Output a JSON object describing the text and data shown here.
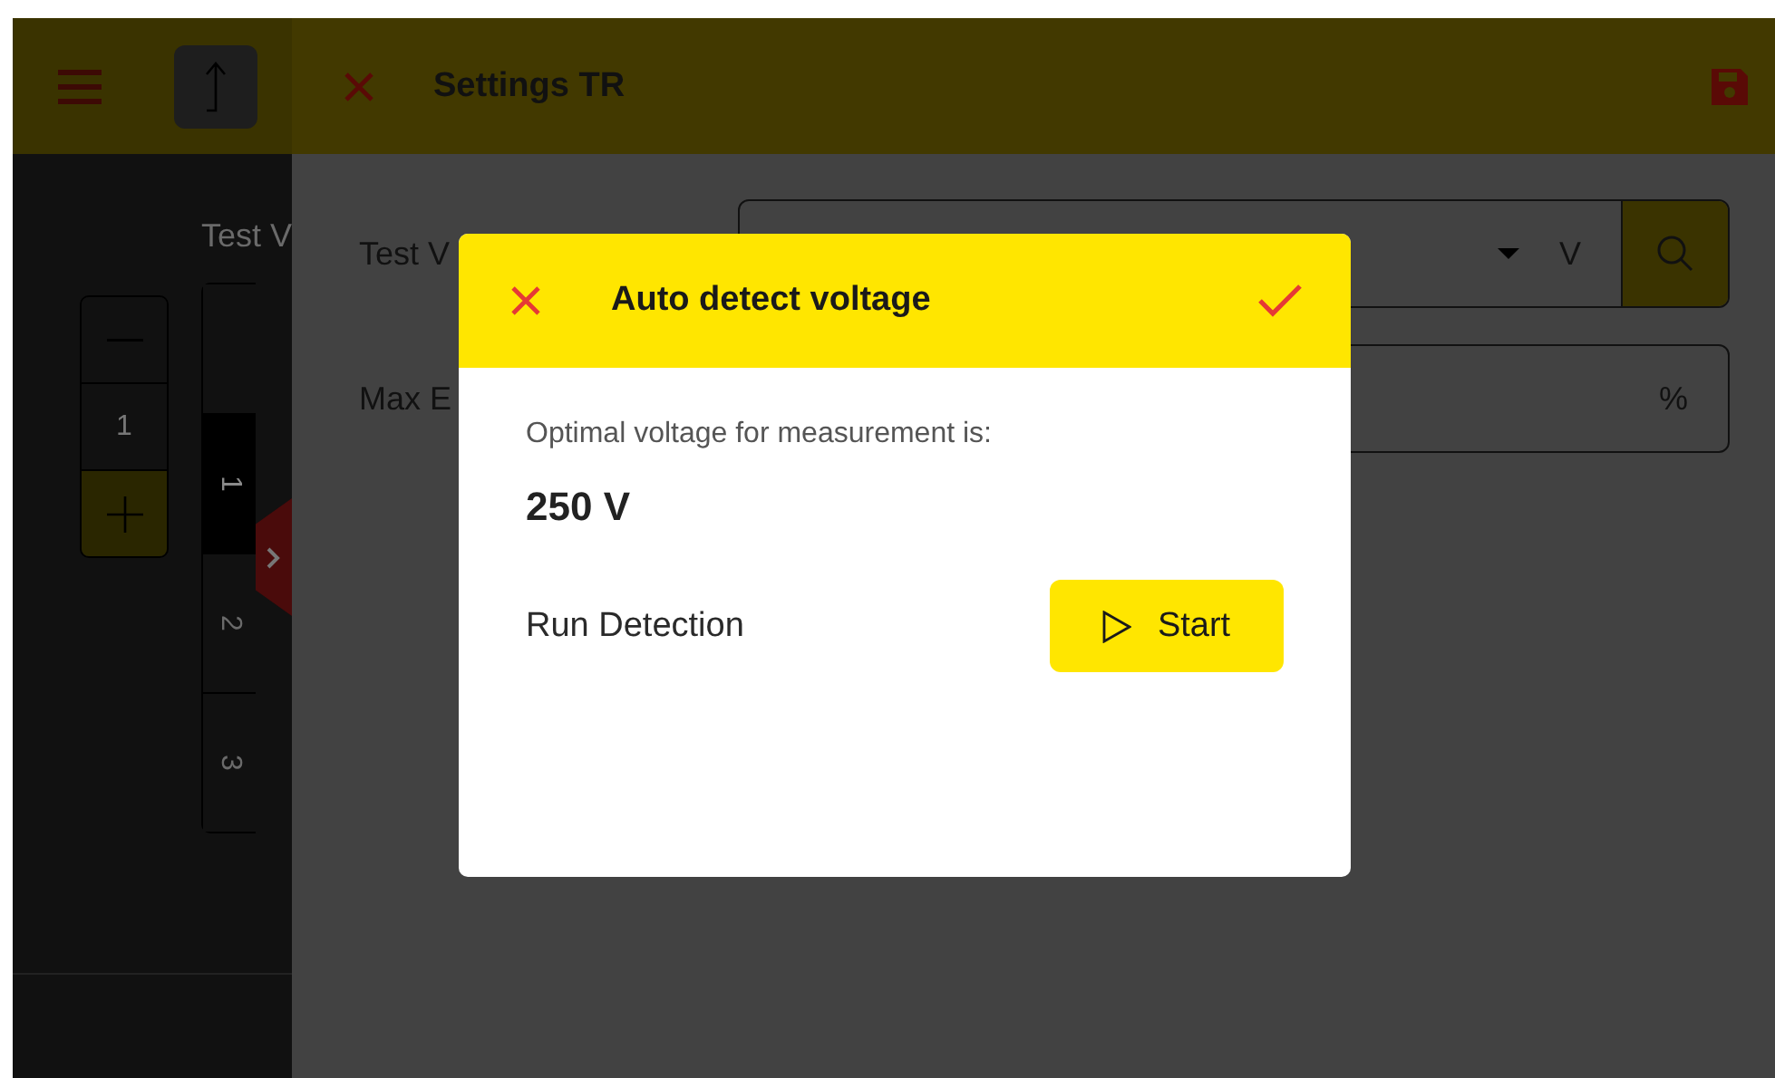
{
  "background_app": {
    "label": "Test V",
    "stepper_value": "1",
    "table_rows": [
      {
        "label": "1",
        "selected": true
      },
      {
        "label": "2",
        "selected": false
      },
      {
        "label": "3",
        "selected": false
      }
    ]
  },
  "settings": {
    "title": "Settings TR",
    "fields": [
      {
        "label": "Test V",
        "unit": "V",
        "kind": "dropdown"
      },
      {
        "label": "Max E",
        "unit": "%",
        "kind": "text"
      }
    ]
  },
  "dialog": {
    "title": "Auto detect voltage",
    "message": "Optimal voltage for measurement is:",
    "value": "250 V",
    "action_label": "Run Detection",
    "button": "Start"
  }
}
